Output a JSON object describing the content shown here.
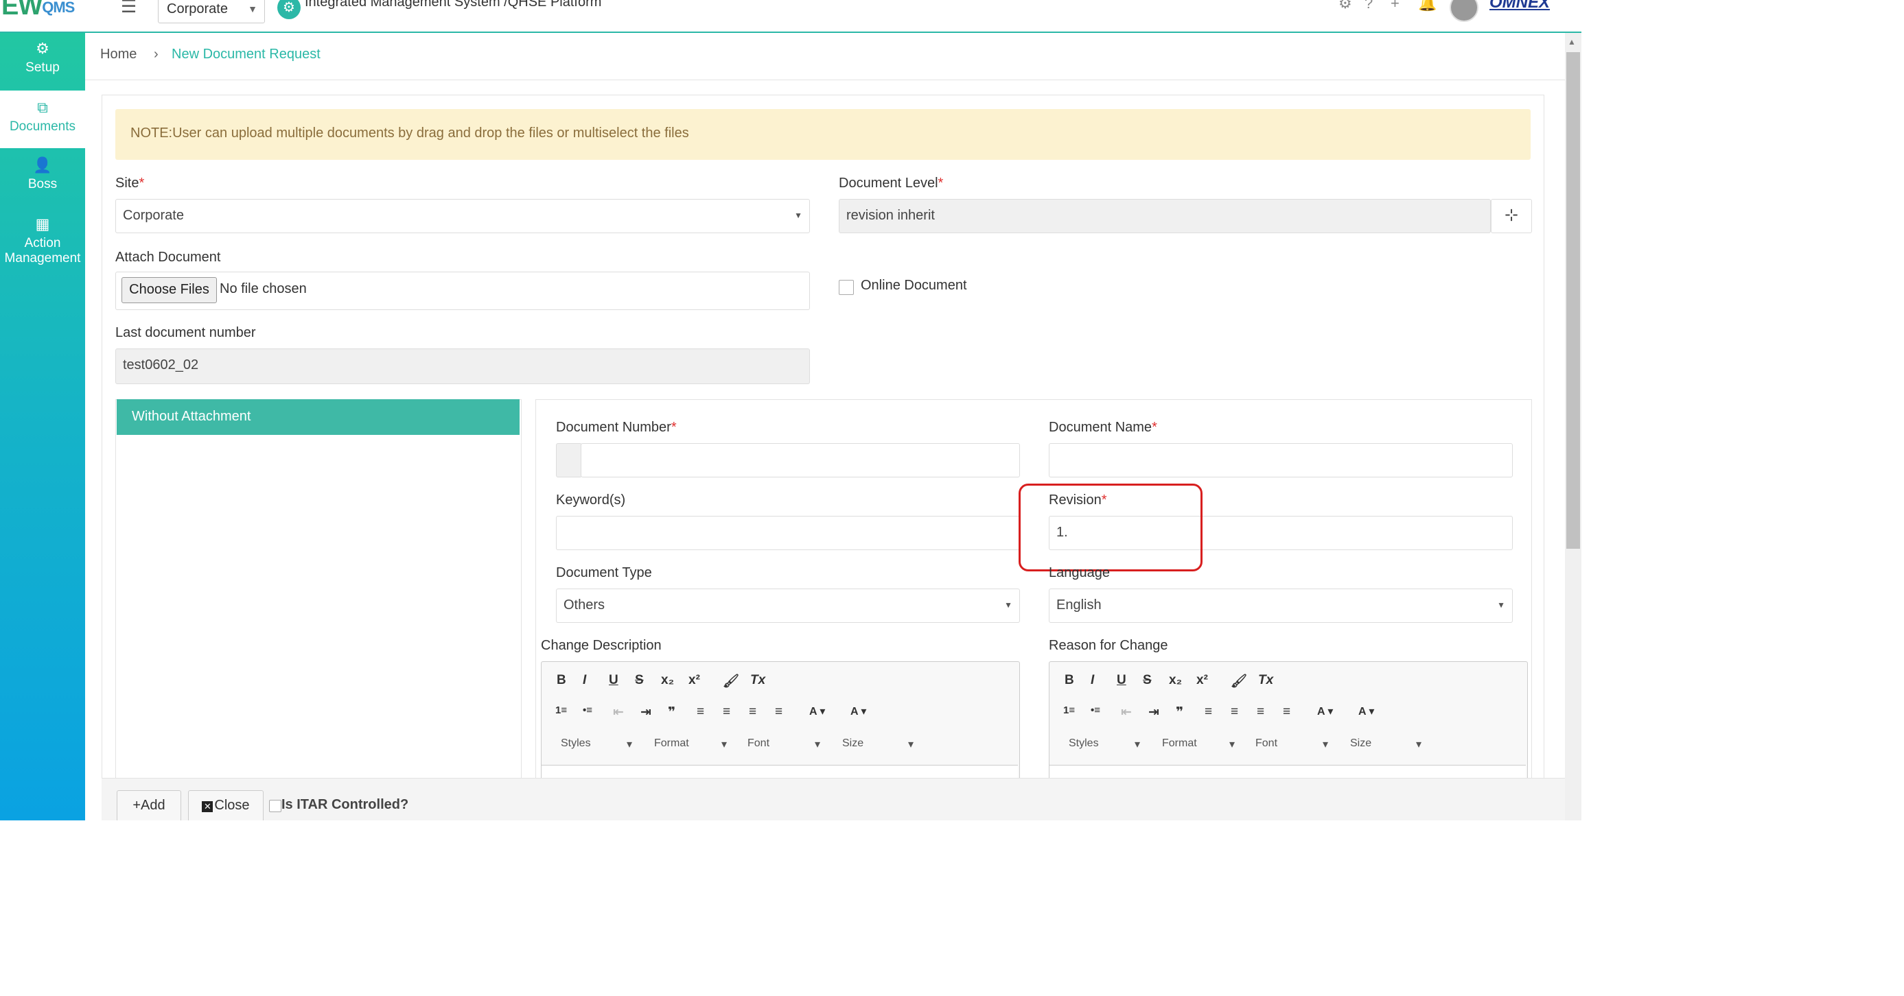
{
  "header": {
    "logo_text": "EW",
    "logo_sub": "QMS",
    "site": "Corporate",
    "app_title": "Integrated Management System /QHSE Platform",
    "brand": "OMNEX",
    "icons": [
      "gear-icon",
      "help-icon",
      "plus-icon",
      "bell-icon"
    ]
  },
  "sidebar": {
    "items": [
      {
        "label": "Setup",
        "icon": "cogs-icon"
      },
      {
        "label": "Documents",
        "icon": "copy-icon",
        "active": true
      },
      {
        "label": "Boss",
        "icon": "user-icon"
      },
      {
        "label": "Action Management",
        "icon": "building-icon"
      }
    ]
  },
  "breadcrumb": {
    "home": "Home",
    "separator": "›",
    "current": "New Document Request"
  },
  "note": "NOTE:User can upload multiple documents by drag and drop the files or multiselect the files",
  "form": {
    "site_label": "Site",
    "site_value": "Corporate",
    "doc_level_label": "Document Level",
    "doc_level_value": "revision inherit",
    "attach_label": "Attach Document",
    "choose_files": "Choose Files",
    "no_file": "No file chosen",
    "online_doc_label": "Online Document",
    "last_doc_label": "Last document number",
    "last_doc_value": "test0602_02",
    "required_mark": "*"
  },
  "without_attachment": {
    "title": "Without Attachment"
  },
  "details": {
    "doc_number_label": "Document Number",
    "doc_number_value": "",
    "doc_name_label": "Document Name",
    "doc_name_value": "",
    "keywords_label": "Keyword(s)",
    "keywords_value": "",
    "revision_label": "Revision",
    "revision_value": "1.",
    "doc_type_label": "Document Type",
    "doc_type_value": "Others",
    "language_label": "Language",
    "language_value": "English",
    "change_desc_label": "Change Description",
    "reason_label": "Reason for Change"
  },
  "editor_toolbar": {
    "row1": [
      "B",
      "I",
      "U",
      "S",
      "x₂",
      "x²",
      "🖌",
      "Tx"
    ],
    "row2": [
      "1≡",
      "•≡",
      "⇤",
      "⇥",
      "❞",
      "≡",
      "≡",
      "≡",
      "≡",
      "A ▾",
      "A ▾"
    ],
    "selects": [
      "Styles",
      "Format",
      "Font",
      "Size"
    ]
  },
  "bottom": {
    "add": "+Add",
    "close": "Close",
    "itar": "Is ITAR Controlled?"
  },
  "colors": {
    "accent": "#2bb8a7",
    "highlight": "#d81f1f",
    "note_bg": "#fcf2d0"
  }
}
